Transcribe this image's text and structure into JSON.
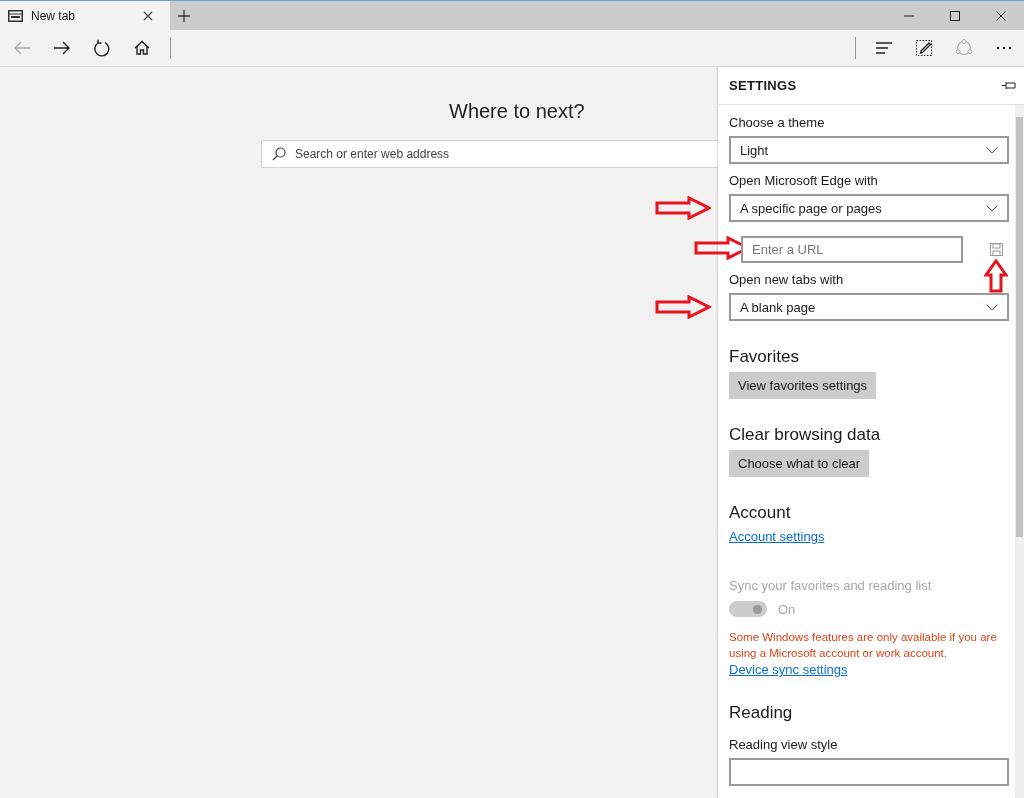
{
  "tab": {
    "title": "New tab",
    "selected": true
  },
  "toolbar": [
    {
      "kind": "back",
      "disabled": true
    },
    {
      "kind": "forward",
      "disabled": false
    },
    {
      "kind": "refresh",
      "disabled": false
    },
    {
      "kind": "home",
      "disabled": false
    }
  ],
  "toolbar_right": [
    {
      "kind": "hub"
    },
    {
      "kind": "note"
    },
    {
      "kind": "share"
    },
    {
      "kind": "more"
    }
  ],
  "new_tab": {
    "heading": "Where to next?",
    "search": {
      "placeholder": "Search or enter web address"
    }
  },
  "settings": {
    "title": "SETTINGS",
    "items": [
      {
        "kind": "label",
        "text": "Choose a theme"
      },
      {
        "kind": "dropdown",
        "value": "Light"
      },
      {
        "kind": "label",
        "text": "Open Microsoft Edge with"
      },
      {
        "kind": "dropdown",
        "value": "A specific page or pages",
        "marked": true
      },
      {
        "kind": "url",
        "placeholder": "Enter a URL",
        "marked": true,
        "save_marked": true
      },
      {
        "kind": "label",
        "text": "Open new tabs with"
      },
      {
        "kind": "dropdown",
        "value": "A blank page",
        "marked": true
      },
      {
        "kind": "heading",
        "text": "Favorites"
      },
      {
        "kind": "button",
        "text": "View favorites settings"
      },
      {
        "kind": "heading",
        "text": "Clear browsing data"
      },
      {
        "kind": "button",
        "text": "Choose what to clear"
      },
      {
        "kind": "heading",
        "text": "Account"
      },
      {
        "kind": "link",
        "text": "Account settings"
      },
      {
        "kind": "toggle",
        "label": "Sync your favorites and reading list",
        "state_text": "On",
        "on": true,
        "disabled": true
      },
      {
        "kind": "warning",
        "text": "Some Windows features are only available if you are using a Microsoft account or work account."
      },
      {
        "kind": "link",
        "text": "Device sync settings"
      },
      {
        "kind": "heading",
        "text": "Reading"
      },
      {
        "kind": "label",
        "text": "Reading view style"
      },
      {
        "kind": "dropdown",
        "value": ""
      }
    ]
  }
}
